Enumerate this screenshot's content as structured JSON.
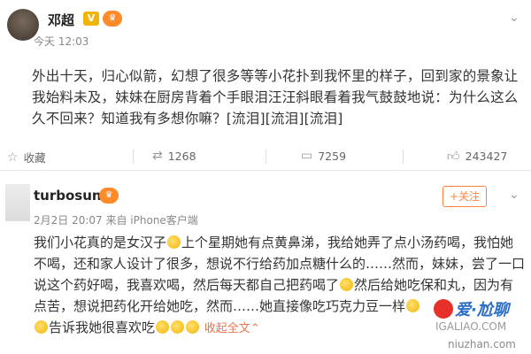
{
  "post1": {
    "username": "邓超",
    "verified_badge": "V",
    "level_badge": "♛",
    "time": "今天 12:03",
    "content": "外出十天，归心似箭，幻想了很多等等小花扑到我怀里的样子，回到家的景象让我始料未及，妹妹在厨房背着个手眼泪汪汪斜眼看着我气鼓鼓地说：为什么这么久不回来？知道我有多想你嘛？[流泪][流泪][流泪]",
    "actions": {
      "favorite_label": "收藏",
      "repost_count": "1268",
      "comment_count": "7259",
      "like_count": "243427"
    }
  },
  "post2": {
    "username": "turbosun",
    "level_badge": "♛",
    "follow_label": "+关注",
    "time": "2月2日 20:07 来自 iPhone客户端",
    "content_part1": "我们小花真的是女汉子",
    "content_part2": "上个星期她有点黄鼻涕，我给她弄了点小汤药喝，我怕她不喝，还和家人设计了很多，想说不行给药加点糖什么的……然而，妹妹，尝了一口说这个药好喝，我喜欢喝，然后每天都自己把药喝了",
    "content_part3": "然后给她吃保和丸，因为有点苦，想说把药化开给她吃，然而……她直接像吃巧克力豆一样",
    "content_part4": "告诉我她很喜欢吃",
    "fold_label": "收起全文"
  },
  "watermark": {
    "brand": "爱·尬聊",
    "site": "IGALIAO.COM",
    "url": "niuzhan.com"
  }
}
